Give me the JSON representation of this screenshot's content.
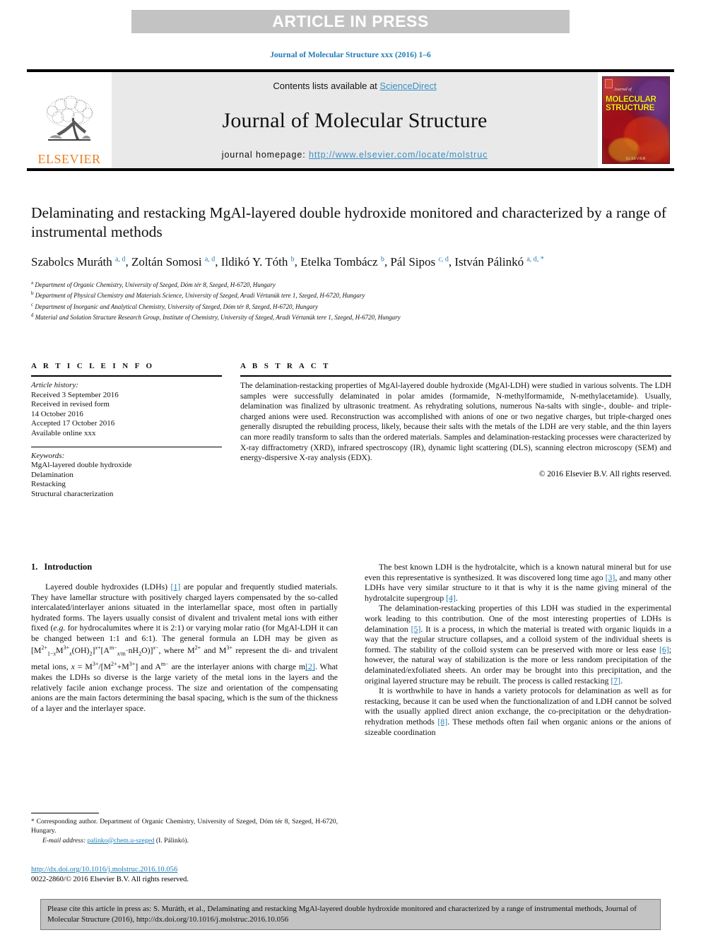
{
  "banner": {
    "label": "ARTICLE IN PRESS"
  },
  "running_head": "Journal of Molecular Structure xxx (2016) 1–6",
  "masthead": {
    "contents_prefix": "Contents lists available at ",
    "sciencedirect": "ScienceDirect",
    "journal_name": "Journal of Molecular Structure",
    "homepage_label": "journal homepage: ",
    "homepage_url": "http://www.elsevier.com/locate/molstruc",
    "publisher_logo_text": "ELSEVIER",
    "cover": {
      "line1": "MOLECULAR",
      "line2": "STRUCTURE",
      "kicker": "Journal of",
      "footer": "ELSEVIER"
    }
  },
  "article": {
    "title": "Delaminating and restacking MgAl-layered double hydroxide monitored and characterized by a range of instrumental methods",
    "authors": [
      {
        "name": "Szabolcs Muráth",
        "marks": "a, d",
        "sep": ", "
      },
      {
        "name": "Zoltán Somosi",
        "marks": "a, d",
        "sep": ", "
      },
      {
        "name": "Ildikó Y. Tóth",
        "marks": "b",
        "sep": ", "
      },
      {
        "name": "Etelka Tombácz",
        "marks": "b",
        "sep": ", "
      },
      {
        "name": "Pál Sipos",
        "marks": "c, d",
        "sep": ", "
      },
      {
        "name": "István Pálinkó",
        "marks": "a, d, *",
        "sep": ""
      }
    ],
    "affiliations": [
      {
        "mark": "a",
        "text": "Department of Organic Chemistry, University of Szeged, Dóm tér 8, Szeged, H-6720, Hungary"
      },
      {
        "mark": "b",
        "text": "Department of Physical Chemistry and Materials Science, University of Szeged, Aradi Vértanúk tere 1, Szeged, H-6720, Hungary"
      },
      {
        "mark": "c",
        "text": "Department of Inorganic and Analytical Chemistry, University of Szeged, Dóm tér 8, Szeged, H-6720, Hungary"
      },
      {
        "mark": "d",
        "text": "Material and Solution Structure Research Group, Institute of Chemistry, University of Szeged, Aradi Vértanúk tere 1, Szeged, H-6720, Hungary"
      }
    ]
  },
  "article_info": {
    "heading": "A R T I C L E  I N F O",
    "history_label": "Article history:",
    "history": [
      "Received 3 September 2016",
      "Received in revised form",
      "14 October 2016",
      "Accepted 17 October 2016",
      "Available online xxx"
    ],
    "keywords_label": "Keywords:",
    "keywords": [
      "MgAl-layered double hydroxide",
      "Delamination",
      "Restacking",
      "Structural characterization"
    ]
  },
  "abstract": {
    "heading": "A B S T R A C T",
    "text": "The delamination-restacking properties of MgAl-layered double hydroxide (MgAl-LDH) were studied in various solvents. The LDH samples were successfully delaminated in polar amides (formamide, N-methylformamide, N-methylacetamide). Usually, delamination was finalized by ultrasonic treatment. As rehydrating solutions, numerous Na-salts with single-, double- and triple-charged anions were used. Reconstruction was accomplished with anions of one or two negative charges, but triple-charged ones generally disrupted the rebuilding process, likely, because their salts with the metals of the LDH are very stable, and the thin layers can more readily transform to salts than the ordered materials. Samples and delamination-restacking processes were characterized by X-ray diffractometry (XRD), infrared spectroscopy (IR), dynamic light scattering (DLS), scanning electron microscopy (SEM) and energy-dispersive X-ray analysis (EDX).",
    "copyright": "© 2016 Elsevier B.V. All rights reserved."
  },
  "body": {
    "section_number": "1.",
    "section_title": "Introduction",
    "left_paragraphs": [
      "Layered double hydroxides (LDHs) [1] are popular and frequently studied materials. They have lamellar structure with positively charged layers compensated by the so-called intercalated/interlayer anions situated in the interlamellar space, most often in partially hydrated forms. The layers usually consist of divalent and trivalent metal ions with either fixed (e.g. for hydrocalumites where it is 2:1) or varying molar ratio (for MgAl-LDH it can be changed between 1:1 and 6:1). The general formula an LDH may be given as",
      "and are the interlayer anions with charge m[2]. What makes the LDHs so diverse is the large variety of the metal ions in the layers and the relatively facile anion exchange process. The size and orientation of the compensating anions are the main factors determining the basal spacing, which is the sum of the thickness of a layer and the interlayer space."
    ],
    "formula_text": "[M2+1−xM3+x(OH)2]x+[Am−x/m·nH2O)]x−, where M2+ and M3+ represent the di- and trivalent metal ions, x = M3+/[M2++M3+]",
    "right_paragraphs": [
      "The best known LDH is the hydrotalcite, which is a known natural mineral but for use even this representative is synthesized. It was discovered long time ago [3], and many other LDHs have very similar structure to it that is why it is the name giving mineral of the hydrotalcite supergroup [4].",
      "The delamination-restacking properties of this LDH was studied in the experimental work leading to this contribution. One of the most interesting properties of LDHs is delamination [5]. It is a process, in which the material is treated with organic liquids in a way that the regular structure collapses, and a colloid system of the individual sheets is formed. The stability of the colloid system can be preserved with more or less ease [6]; however, the natural way of stabilization is the more or less random precipitation of the delaminated/exfoliated sheets. An order may be brought into this precipitation, and the original layered structure may be rebuilt. The process is called restacking [7].",
      "It is worthwhile to have in hands a variety protocols for delamination as well as for restacking, because it can be used when the functionalization of and LDH cannot be solved with the usually applied direct anion exchange, the co-precipitation or the dehydration-rehydration methods [8]. These methods often fail when organic anions or the anions of sizeable coordination"
    ]
  },
  "footnote": {
    "star": "*",
    "corresponding": "Corresponding author. Department of Organic Chemistry, University of Szeged, Dóm tér 8, Szeged, H-6720, Hungary.",
    "email_label": "E-mail address:",
    "email": "palinko@chem.u-szeged",
    "email_owner": "(I. Pálinkó)."
  },
  "doi_block": {
    "doi_url": "http://dx.doi.org/10.1016/j.molstruc.2016.10.056",
    "issn_line": "0022-2860/© 2016 Elsevier B.V. All rights reserved."
  },
  "cite_box": {
    "text": "Please cite this article in press as: S. Muráth, et al., Delaminating and restacking MgAl-layered double hydroxide monitored and characterized by a range of instrumental methods, Journal of Molecular Structure (2016), http://dx.doi.org/10.1016/j.molstruc.2016.10.056"
  },
  "colors": {
    "link_blue": "#1f7bb6",
    "sciencedirect_blue": "#3a8fc4",
    "elsevier_orange": "#ef7d20",
    "banner_gray": "#c3c3c3",
    "masthead_gray": "#e9e9e9"
  }
}
